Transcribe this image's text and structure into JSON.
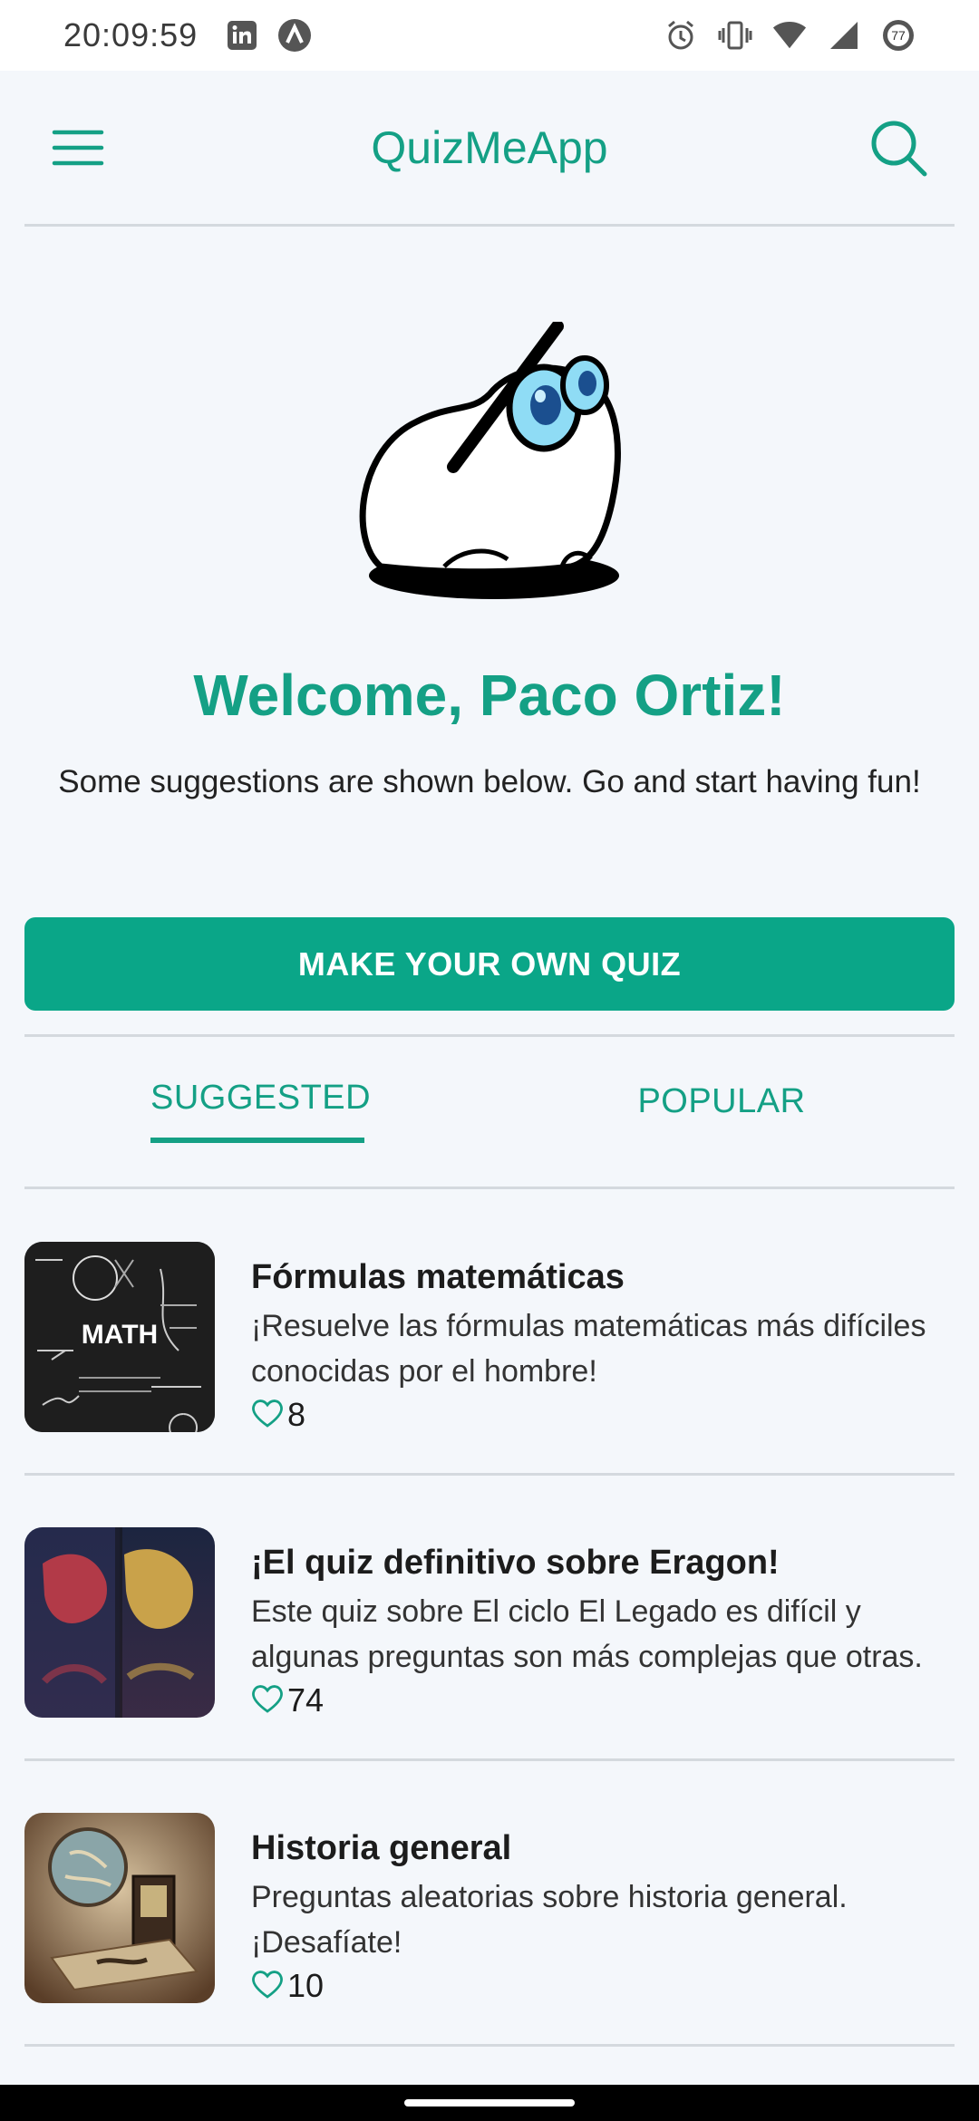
{
  "status_bar": {
    "time": "20:09:59",
    "battery": "77",
    "left_icons": [
      "linkedin-icon",
      "arc-icon"
    ],
    "right_icons": [
      "alarm-icon",
      "vibrate-icon",
      "wifi-icon",
      "signal-icon",
      "battery-icon"
    ]
  },
  "app_bar": {
    "title": "QuizMeApp",
    "menu_icon": "menu-icon",
    "search_icon": "search-icon"
  },
  "hero": {
    "welcome": "Welcome, Paco Ortiz!",
    "subtitle": "Some suggestions are shown below. Go and start having fun!"
  },
  "cta": {
    "label": "MAKE YOUR OWN QUIZ"
  },
  "tabs": [
    {
      "label": "SUGGESTED",
      "active": true
    },
    {
      "label": "POPULAR",
      "active": false
    }
  ],
  "quizzes": [
    {
      "title": "Fórmulas matemáticas",
      "description": "¡Resuelve las fórmulas matemáticas más difíciles conocidas por el hombre!",
      "likes": "8",
      "thumb_text": "MATH"
    },
    {
      "title": "¡El quiz definitivo sobre Eragon!",
      "description": "Este quiz sobre El ciclo El Legado es difícil y algunas preguntas son más complejas que otras.",
      "likes": "74"
    },
    {
      "title": "Historia general",
      "description": "Preguntas aleatorias sobre historia general. ¡Desafíate!",
      "likes": "10"
    }
  ],
  "colors": {
    "accent": "#14a085",
    "button": "#0aa688",
    "background": "#f4f7fb",
    "divider": "#d4d9de"
  }
}
